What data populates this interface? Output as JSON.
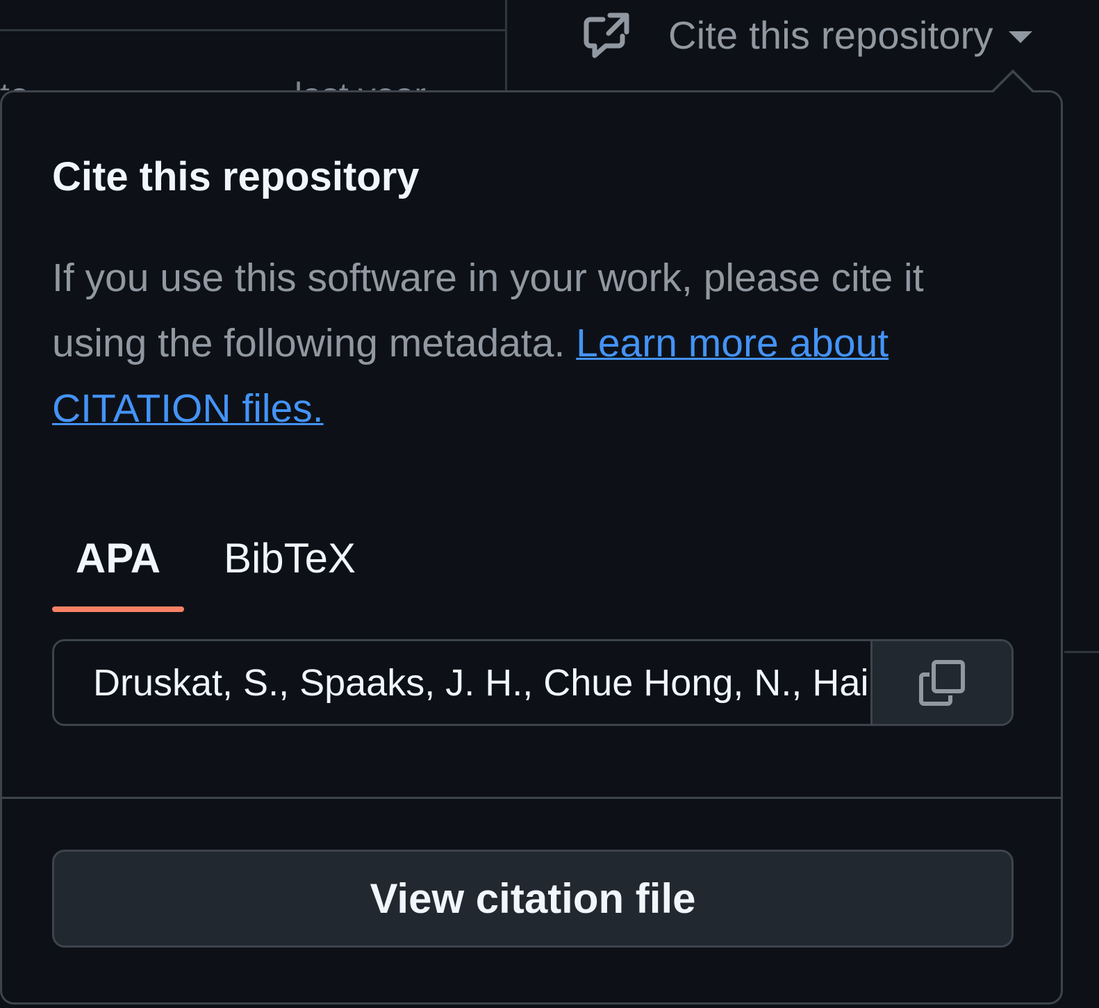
{
  "background": {
    "clipped_text_left": "to",
    "clipped_text_right": "last year"
  },
  "trigger": {
    "icon": "external-cite-icon",
    "label": "Cite this repository",
    "caret_icon": "caret-down-icon"
  },
  "popover": {
    "title": "Cite this repository",
    "description": "If you use this software in your work, please cite it using the following metadata.",
    "link_text": "Learn more about CITATION files.",
    "tabs": [
      {
        "label": "APA",
        "selected": true
      },
      {
        "label": "BibTeX",
        "selected": false
      }
    ],
    "citation_value": "Druskat, S., Spaaks, J. H., Chue Hong, N., Haines",
    "copy_icon": "copy-icon",
    "view_button_label": "View citation file"
  },
  "colors": {
    "background": "#0d1117",
    "border": "#3d444d",
    "text_primary": "#f0f6fc",
    "text_muted": "#9198a1",
    "link": "#4493f8",
    "tab_underline": "#f78166",
    "button_bg": "#212830"
  }
}
